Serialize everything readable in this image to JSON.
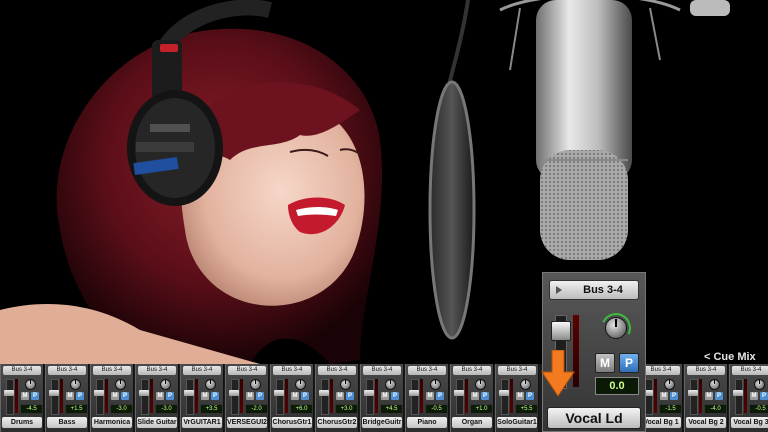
{
  "overlay": {
    "cue_mix_label": "< Cue Mix",
    "accent_color": "#f47a1f"
  },
  "selected_channel": {
    "bus": "Bus 3-4",
    "mute": "M",
    "pre": "P",
    "send_level": "0.0",
    "name": "Vocal Ld"
  },
  "channels": [
    {
      "name": "Drums",
      "bus": "Bus 3-4",
      "level": "-4.5"
    },
    {
      "name": "Bass",
      "bus": "Bus 3-4",
      "level": "+1.5"
    },
    {
      "name": "Harmonica",
      "bus": "Bus 3-4",
      "level": "-3.0"
    },
    {
      "name": "Slide Guitar",
      "bus": "Bus 3-4",
      "level": "-3.0"
    },
    {
      "name": "VrGUITAR1",
      "bus": "Bus 3-4",
      "level": "+3.5"
    },
    {
      "name": "VERSEGUI2",
      "bus": "Bus 3-4",
      "level": "-2.0"
    },
    {
      "name": "ChorusGtr1",
      "bus": "Bus 3-4",
      "level": "+6.0"
    },
    {
      "name": "ChorusGtr2",
      "bus": "Bus 3-4",
      "level": "+3.0"
    },
    {
      "name": "BridgeGuitr",
      "bus": "Bus 3-4",
      "level": "+4.5"
    },
    {
      "name": "Piano",
      "bus": "Bus 3-4",
      "level": "-0.5"
    },
    {
      "name": "Organ",
      "bus": "Bus 3-4",
      "level": "+1.0"
    },
    {
      "name": "SoloGuitar1",
      "bus": "Bus 3-4",
      "level": "+5.5"
    },
    {
      "name": "Vocal Bg 1",
      "bus": "Bus 3-4",
      "level": "-1.5"
    },
    {
      "name": "Vocal Bg 2",
      "bus": "Bus 3-4",
      "level": "-4.0"
    },
    {
      "name": "Vocal Bg 3",
      "bus": "Bus 3-4",
      "level": "-0.5"
    }
  ],
  "strip_buttons": {
    "mute": "M",
    "pre": "P"
  }
}
